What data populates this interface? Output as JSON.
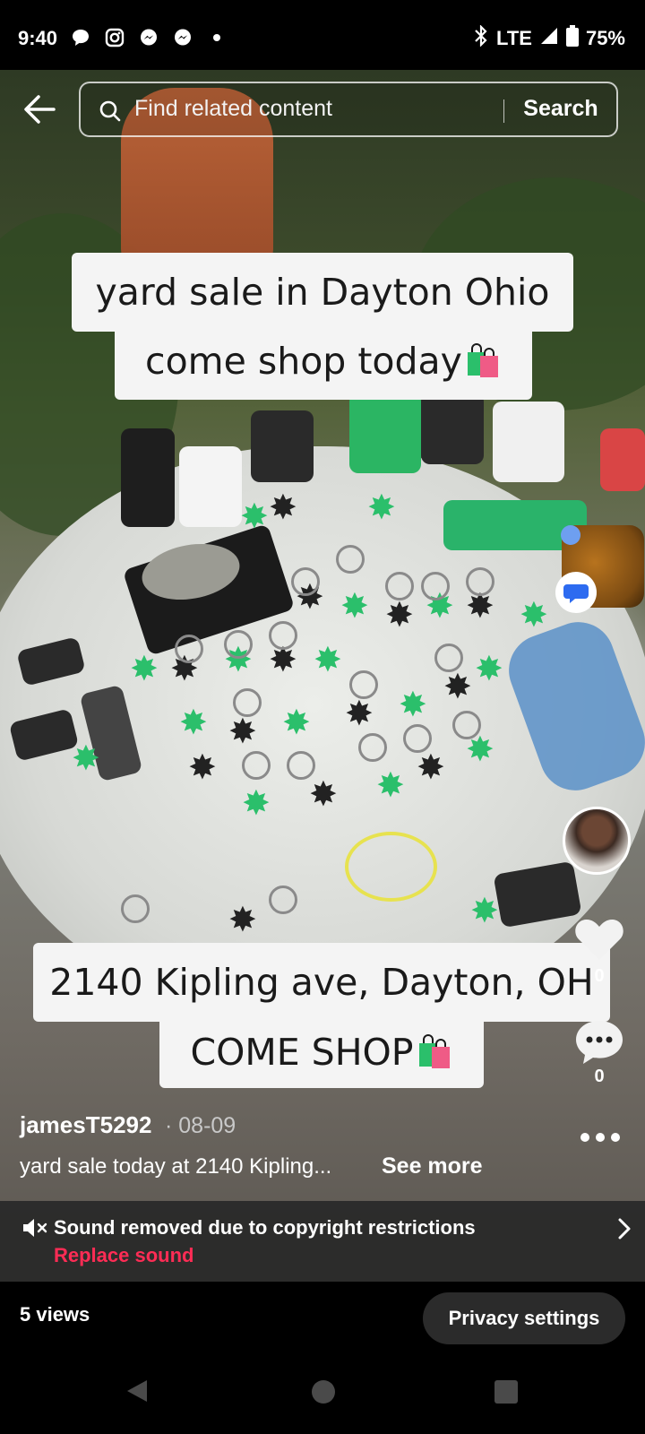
{
  "status_bar": {
    "time": "9:40",
    "network": "LTE",
    "battery": "75%",
    "icons": [
      "chat-bubble-icon",
      "instagram-icon",
      "messenger-icon",
      "messenger-icon",
      "dot-icon",
      "bluetooth-icon",
      "signal-icon",
      "battery-icon"
    ]
  },
  "search": {
    "placeholder": "Find related content",
    "button_label": "Search"
  },
  "captions": {
    "line1": "yard sale in Dayton Ohio",
    "line2": "come shop today",
    "line3": "2140 Kipling ave, Dayton, OH",
    "line4": "COME SHOP"
  },
  "side_actions": {
    "like_count": "0",
    "comment_count": "0"
  },
  "post": {
    "username": "jamesT5292",
    "date": "· 08-09",
    "description": "yard sale today at 2140 Kipling...",
    "see_more": "See more"
  },
  "sound": {
    "notice": "Sound removed due to copyright restrictions",
    "replace": "Replace sound"
  },
  "footer": {
    "views": "5 views",
    "privacy_button": "Privacy settings"
  },
  "colors": {
    "accent_red": "#fe2c55",
    "caption_bg": "#f4f4f4",
    "bag_green": "#2bbf6b",
    "bag_pink": "#ef5b86"
  }
}
